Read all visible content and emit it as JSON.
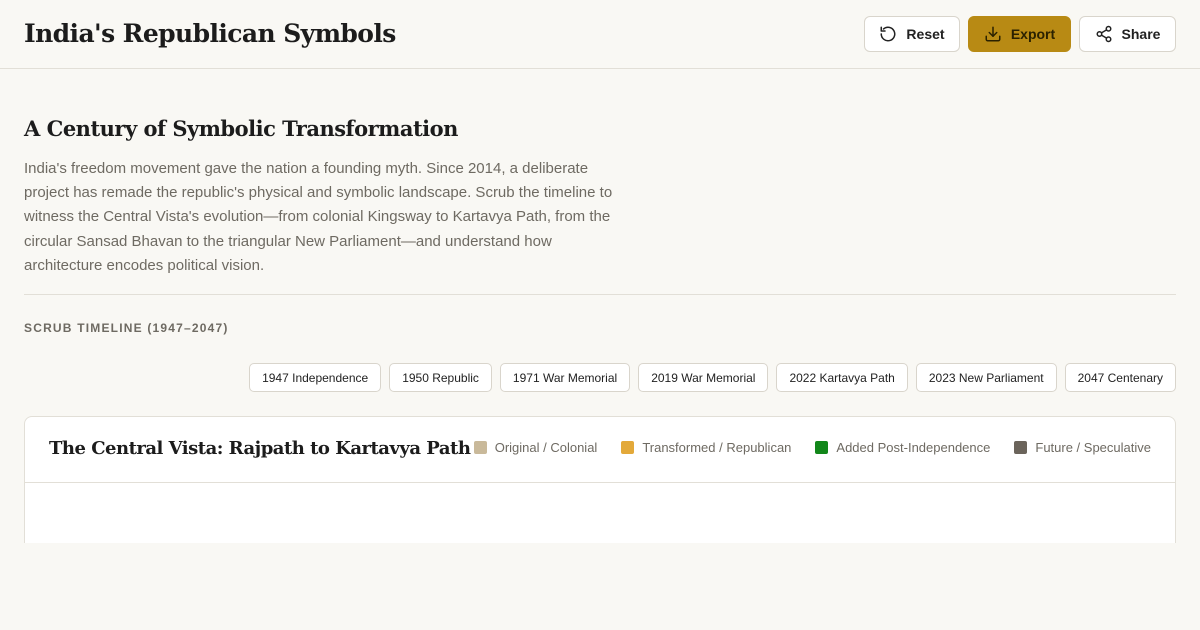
{
  "header": {
    "title": "India's Republican Symbols",
    "buttons": {
      "reset": "Reset",
      "export": "Export",
      "share": "Share"
    }
  },
  "intro": {
    "heading": "A Century of Symbolic Transformation",
    "body": "India's freedom movement gave the nation a founding myth. Since 2014, a deliberate project has remade the republic's physical and symbolic landscape. Scrub the timeline to witness the Central Vista's evolution—from colonial Kingsway to Kartavya Path, from the circular Sansad Bhavan to the triangular New Parliament—and understand how architecture encodes political vision."
  },
  "timeline": {
    "label": "SCRUB TIMELINE (1947–2047)",
    "milestones": [
      "1947 Independence",
      "1950 Republic",
      "1971 War Memorial",
      "2019 War Memorial",
      "2022 Kartavya Path",
      "2023 New Parliament",
      "2047 Centenary"
    ]
  },
  "panel": {
    "title": "The Central Vista: Rajpath to Kartavya Path",
    "legend": [
      {
        "label": "Original / Colonial",
        "color": "#c9b99a"
      },
      {
        "label": "Transformed / Republican",
        "color": "#e3a93a"
      },
      {
        "label": "Added Post-Independence",
        "color": "#12871a"
      },
      {
        "label": "Future / Speculative",
        "color": "#6b645b"
      }
    ]
  },
  "colors": {
    "accent": "#b88a14",
    "background": "#f9f8f4",
    "border": "#e2dfd7"
  }
}
